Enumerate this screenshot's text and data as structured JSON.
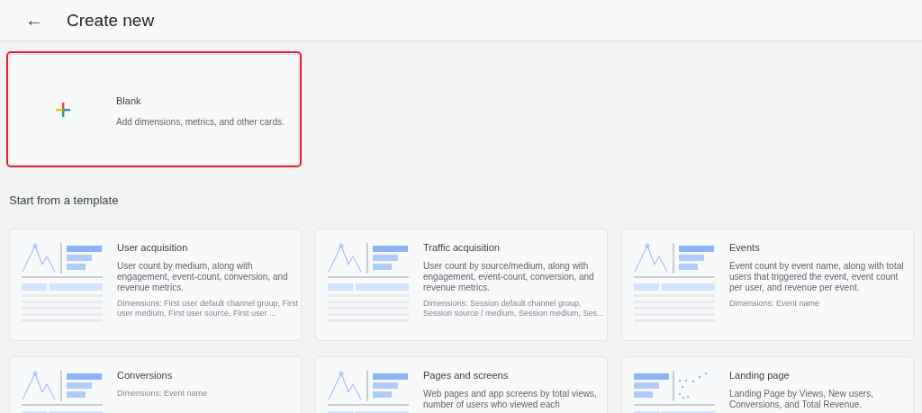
{
  "header": {
    "back": "←",
    "title": "Create new"
  },
  "blank_card": {
    "title": "Blank",
    "description": "Add dimensions, metrics, and other cards.",
    "selected": true
  },
  "section_title": "Start from a template",
  "templates": [
    {
      "kind": "line",
      "title": "User acquisition",
      "description": "User count by medium, along with engagement, event-count, conversion, and revenue metrics.",
      "dimensions": "Dimensions: First user default channel group, First user medium, First user source, First user ..."
    },
    {
      "kind": "line",
      "title": "Traffic acquisition",
      "description": "User count by source/medium, along with engagement, event-count, conversion, and revenue metrics.",
      "dimensions": "Dimensions: Session default channel group, Session source / medium, Session medium, Ses..."
    },
    {
      "kind": "line",
      "title": "Events",
      "description": "Event count by event name, along with total users that triggered the event, event count per user, and revenue per event.",
      "dimensions": "Dimensions: Event name"
    },
    {
      "kind": "line",
      "title": "Conversions",
      "dimensions": "Dimensions: Event name"
    },
    {
      "kind": "line",
      "title": "Pages and screens",
      "description": "Web pages and app screens by total views, number of users who viewed each"
    },
    {
      "kind": "scatter",
      "title": "Landing page",
      "description": "Landing Page by Views, New users, Conversions, and Total Revenue."
    }
  ]
}
